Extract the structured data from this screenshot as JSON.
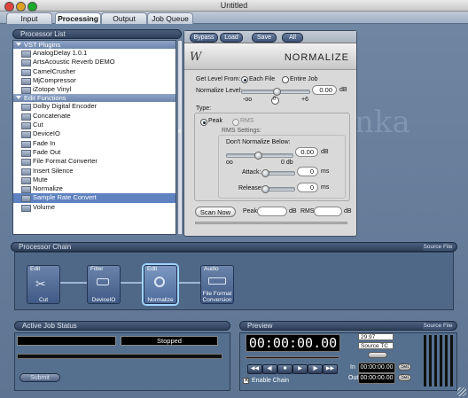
{
  "window": {
    "title": "Untitled"
  },
  "tabs": [
    {
      "label": "Input",
      "active": false
    },
    {
      "label": "Processing",
      "active": true
    },
    {
      "label": "Output",
      "active": false
    },
    {
      "label": "Job Queue",
      "active": false
    }
  ],
  "processor_list": {
    "header": "Processor List",
    "groups": [
      {
        "label": "VST Plugins",
        "items": [
          "AnalogDelay 1.0.1",
          "ArtsAcoustic Reverb DEMO",
          "CamelCrusher",
          "MjCompressor",
          "iZotope Vinyl"
        ]
      },
      {
        "label": "Edit Functions",
        "items": [
          "Dolby Digital Encoder",
          "Concatenate",
          "Cut",
          "DeviceIO",
          "Fade In",
          "Fade Out",
          "File Format Converter",
          "Insert Silence",
          "Mute",
          "Normalize",
          "Sample Rate Convert",
          "Volume"
        ]
      }
    ],
    "selected": "Sample Rate Convert"
  },
  "normalize": {
    "toolbar": [
      "Bypass",
      "Load",
      "Save",
      "All"
    ],
    "title": "NORMALIZE",
    "get_level_label": "Get Level From:",
    "each_file": "Each File",
    "entire_job": "Entire Job",
    "level_label": "Normalize Level:",
    "level_value": "0.00",
    "level_unit": "dB",
    "level_min": "-oo",
    "level_mid": "0",
    "level_max": "+6",
    "type_label": "Type:",
    "peak": "Peak",
    "rms": "RMS",
    "rms_settings": "RMS Settings:",
    "dont_norm": "Don't Normalize Below:",
    "below_value": "0.00",
    "below_unit": "dB",
    "below_min": "oo",
    "below_max": "0 db",
    "attack_label": "Attack:",
    "attack_value": "0",
    "attack_unit": "ms",
    "release_label": "Release:",
    "release_value": "0",
    "release_unit": "ms",
    "scan_button": "Scan Now",
    "peak_label": "Peak:",
    "peak_unit": "dB",
    "rms_label": "RMS:",
    "rms_unit": "dB"
  },
  "processor_chain": {
    "header": "Processor Chain",
    "source_file": "Source File",
    "nodes": [
      {
        "title": "Edit",
        "label": "Cut"
      },
      {
        "title": "Filter",
        "label": "DeviceIO"
      },
      {
        "title": "Edit",
        "label": "Normalize"
      },
      {
        "title": "Audio",
        "label": "File Format Conversion"
      }
    ]
  },
  "job_status": {
    "header": "Active Job Status",
    "status": "Stopped",
    "submit": "Submit"
  },
  "preview": {
    "header": "Preview",
    "source_file": "Source File",
    "timecode": "00:00:00.00",
    "fps": "29.97",
    "source_tc": "Source TC",
    "in_label": "In",
    "in_value": "00:00:00.00",
    "out_label": "Out",
    "out_value": "00:00:00.00",
    "set": "Set",
    "enable_chain": "Enable Chain",
    "transport": [
      "◀◀",
      "◀|",
      "■",
      "▶",
      "|▶",
      "▶▶"
    ]
  },
  "background_text": "nka",
  "colors": {
    "accent": "#5f82c0",
    "panel": "#d9d9d9",
    "lcd": "#000000"
  }
}
